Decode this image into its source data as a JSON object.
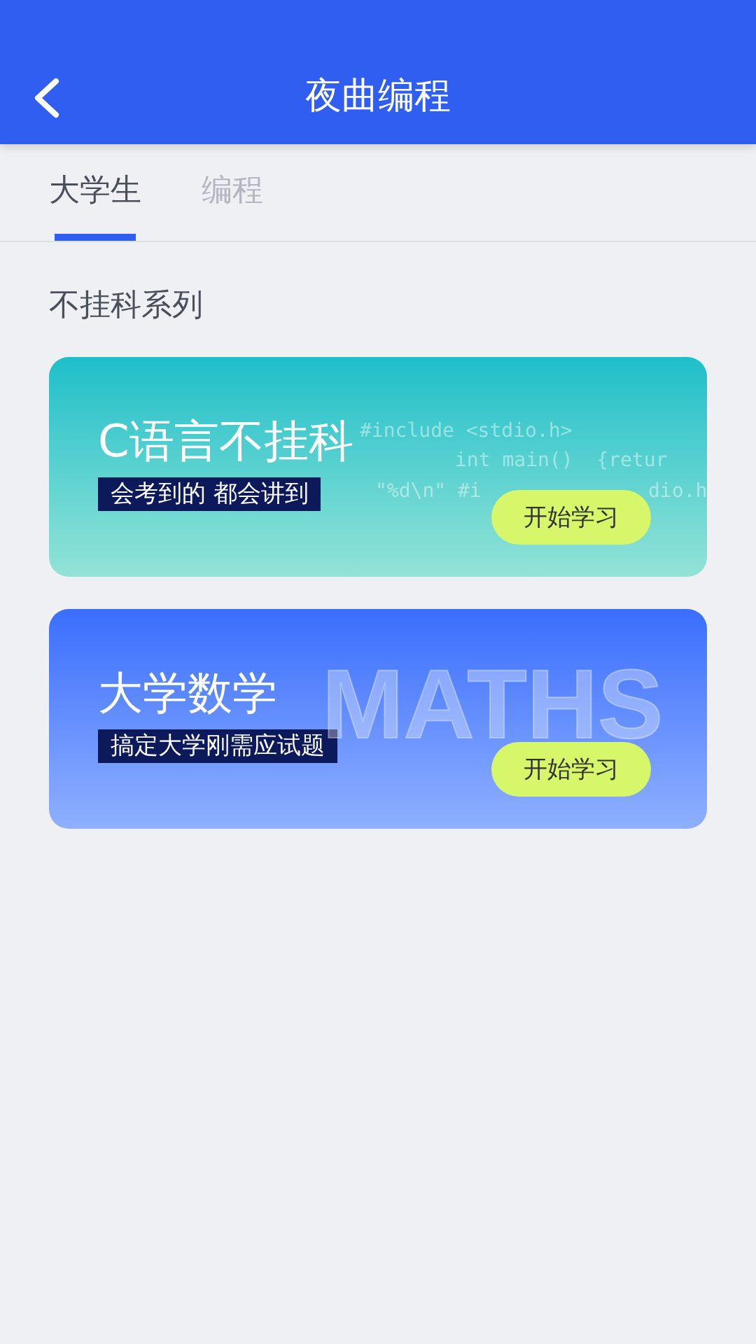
{
  "header": {
    "title": "夜曲编程"
  },
  "tabs": [
    {
      "label": "大学生",
      "selected": true
    },
    {
      "label": "编程",
      "selected": false
    }
  ],
  "section_title": "不挂科系列",
  "cards": [
    {
      "kind": "code",
      "title": "C语言不挂科",
      "tagline": "会考到的 都会讲到",
      "button": "开始学习",
      "code_lines": [
        [
          "#include <stdio.h>"
        ],
        [
          "int main()  {retur"
        ],
        [
          "\"%d\\n\" #i",
          "dio.h"
        ]
      ]
    },
    {
      "kind": "maths",
      "title": "大学数学",
      "tagline": "搞定大学刚需应试题",
      "button": "开始学习",
      "backdrop_word": "MATHS"
    }
  ]
}
